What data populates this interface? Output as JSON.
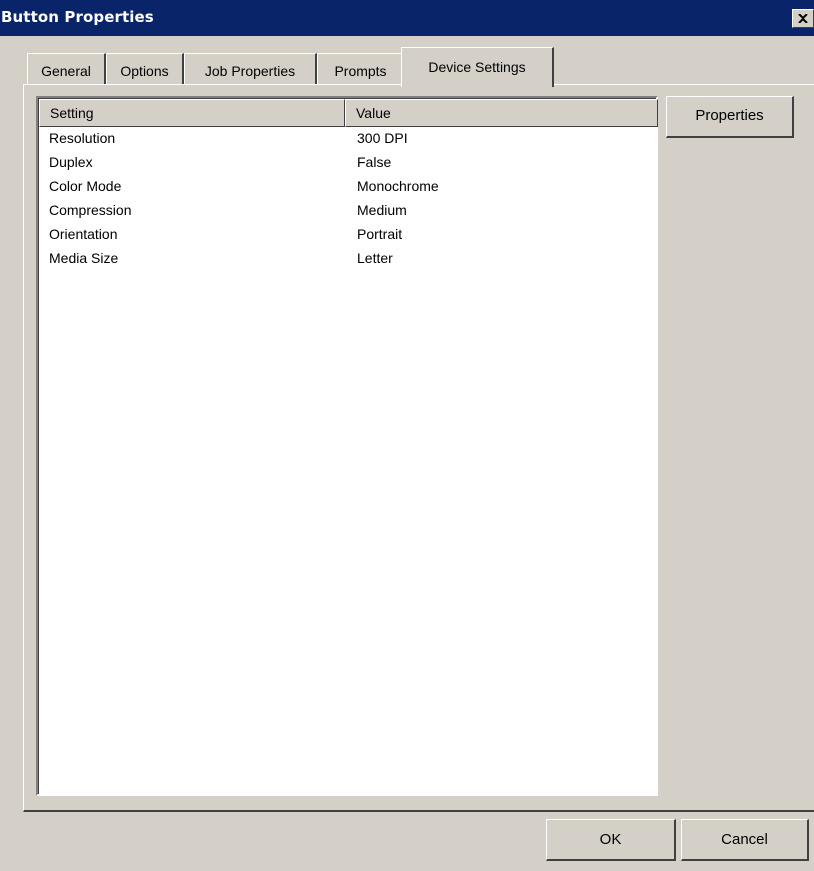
{
  "window": {
    "title": "Button Properties"
  },
  "tabs": [
    {
      "label": "General"
    },
    {
      "label": "Options"
    },
    {
      "label": "Job Properties"
    },
    {
      "label": "Prompts"
    },
    {
      "label": "Device Settings",
      "selected": true
    }
  ],
  "list": {
    "columns": [
      "Setting",
      "Value"
    ],
    "rows": [
      {
        "setting": "Resolution",
        "value": "300 DPI"
      },
      {
        "setting": "Duplex",
        "value": "False"
      },
      {
        "setting": "Color Mode",
        "value": "Monochrome"
      },
      {
        "setting": "Compression",
        "value": "Medium"
      },
      {
        "setting": "Orientation",
        "value": "Portrait"
      },
      {
        "setting": "Media Size",
        "value": "Letter"
      }
    ]
  },
  "buttons": {
    "properties": "Properties",
    "ok": "OK",
    "cancel": "Cancel"
  },
  "icons": {
    "close": "close-icon"
  },
  "colors": {
    "titlebar": "#0a246a",
    "face": "#d4d0c8"
  }
}
